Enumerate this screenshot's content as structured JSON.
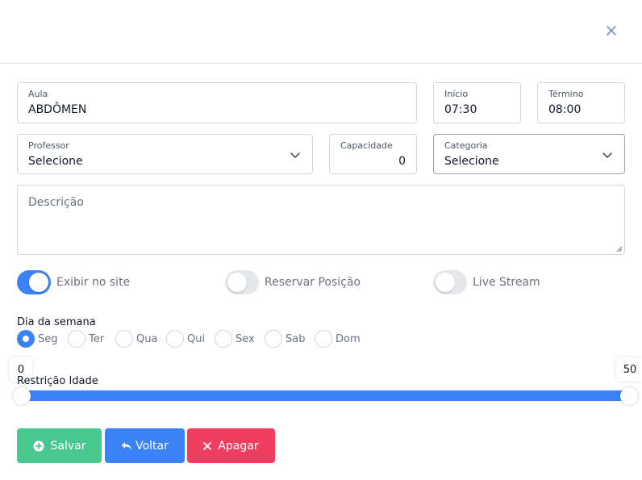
{
  "header": {
    "close_icon": "close-icon"
  },
  "form": {
    "aula": {
      "label": "Aula",
      "value": "ABDÔMEN"
    },
    "inicio": {
      "label": "Início",
      "value": "07:30"
    },
    "termino": {
      "label": "Término",
      "value": "08:00"
    },
    "professor": {
      "label": "Professor",
      "value": "Selecione"
    },
    "capacidade": {
      "label": "Capacidade",
      "value": "0"
    },
    "categoria": {
      "label": "Categoria",
      "value": "Selecione"
    },
    "descricao": {
      "placeholder": "Descrição"
    }
  },
  "toggles": [
    {
      "label": "Exibir no site",
      "on": true
    },
    {
      "label": "Reservar Posição",
      "on": false
    },
    {
      "label": "Live Stream",
      "on": false
    }
  ],
  "weekdays": {
    "label": "Dia da semana",
    "options": [
      "Seg",
      "Ter",
      "Qua",
      "Qui",
      "Sex",
      "Sab",
      "Dom"
    ],
    "selected": "Seg"
  },
  "age_restriction": {
    "label": "Restrição Idade",
    "min_label": "0",
    "max_label": "50",
    "range": [
      0,
      50
    ]
  },
  "buttons": {
    "save": {
      "label": "Salvar",
      "color": "#48c78e"
    },
    "back": {
      "label": "Voltar",
      "color": "#3b82f6"
    },
    "delete": {
      "label": "Apagar",
      "color": "#ef3e5f"
    }
  },
  "colors": {
    "accent": "#3b82f6"
  }
}
